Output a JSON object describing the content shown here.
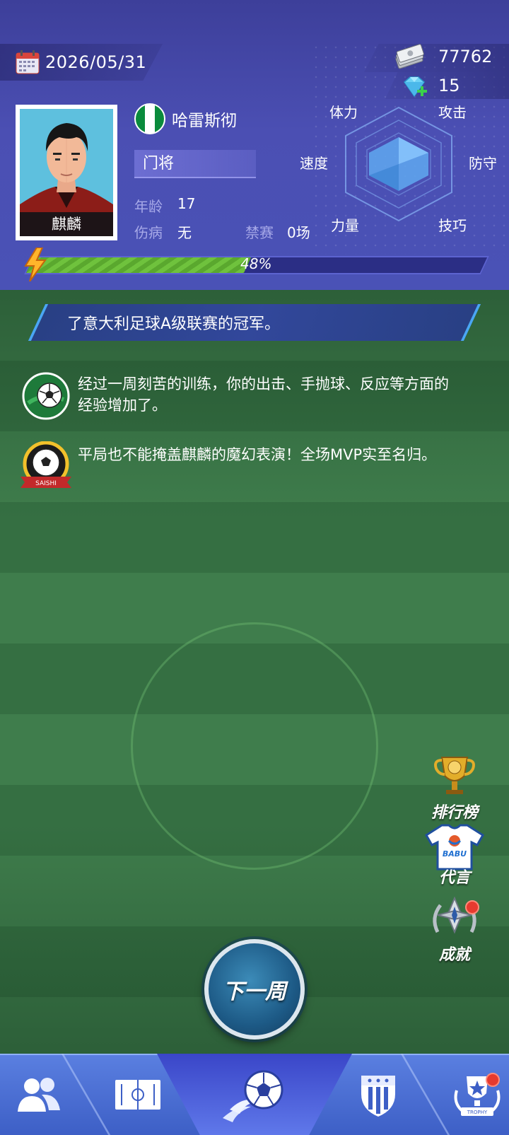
{
  "header": {
    "date": "2026/05/31",
    "cash": "77762",
    "gems": "15"
  },
  "player": {
    "name": "麒麟",
    "team": "哈雷斯彻",
    "position": "门将",
    "age_label": "年龄",
    "age": "17",
    "injury_label": "伤病",
    "injury": "无",
    "ban_label": "禁赛",
    "ban": "0场"
  },
  "radar": {
    "labels": {
      "stamina": "体力",
      "attack": "攻击",
      "speed": "速度",
      "defense": "防守",
      "strength": "力量",
      "skill": "技巧"
    }
  },
  "progress": {
    "value": 48,
    "label": "48%"
  },
  "news": {
    "banner": "了意大利足球A级联赛的冠军。",
    "items": [
      {
        "text": "经过一周刻苦的训练，你的出击、手抛球、反应等方面的经验增加了。",
        "icon": "soccer-ball-green-icon"
      },
      {
        "text": "平局也不能掩盖麒麟的魔幻表演！全场MVP实至名归。",
        "icon": "saishi-badge-icon",
        "badge_text": "SAISHI"
      }
    ]
  },
  "side_buttons": {
    "ranking": "排行榜",
    "endorsement": "代言",
    "endorsement_jersey": "BABU",
    "achievements": "成就"
  },
  "next_week": "下一周",
  "bottom_nav": {
    "trophy_text": "TROPHY"
  },
  "colors": {
    "header_bg": "#4b4fb3",
    "progress_fill": "#6fc23d",
    "field": "#3f7d4c",
    "nav": "#5a7fe0",
    "notification": "#e63a2f"
  }
}
